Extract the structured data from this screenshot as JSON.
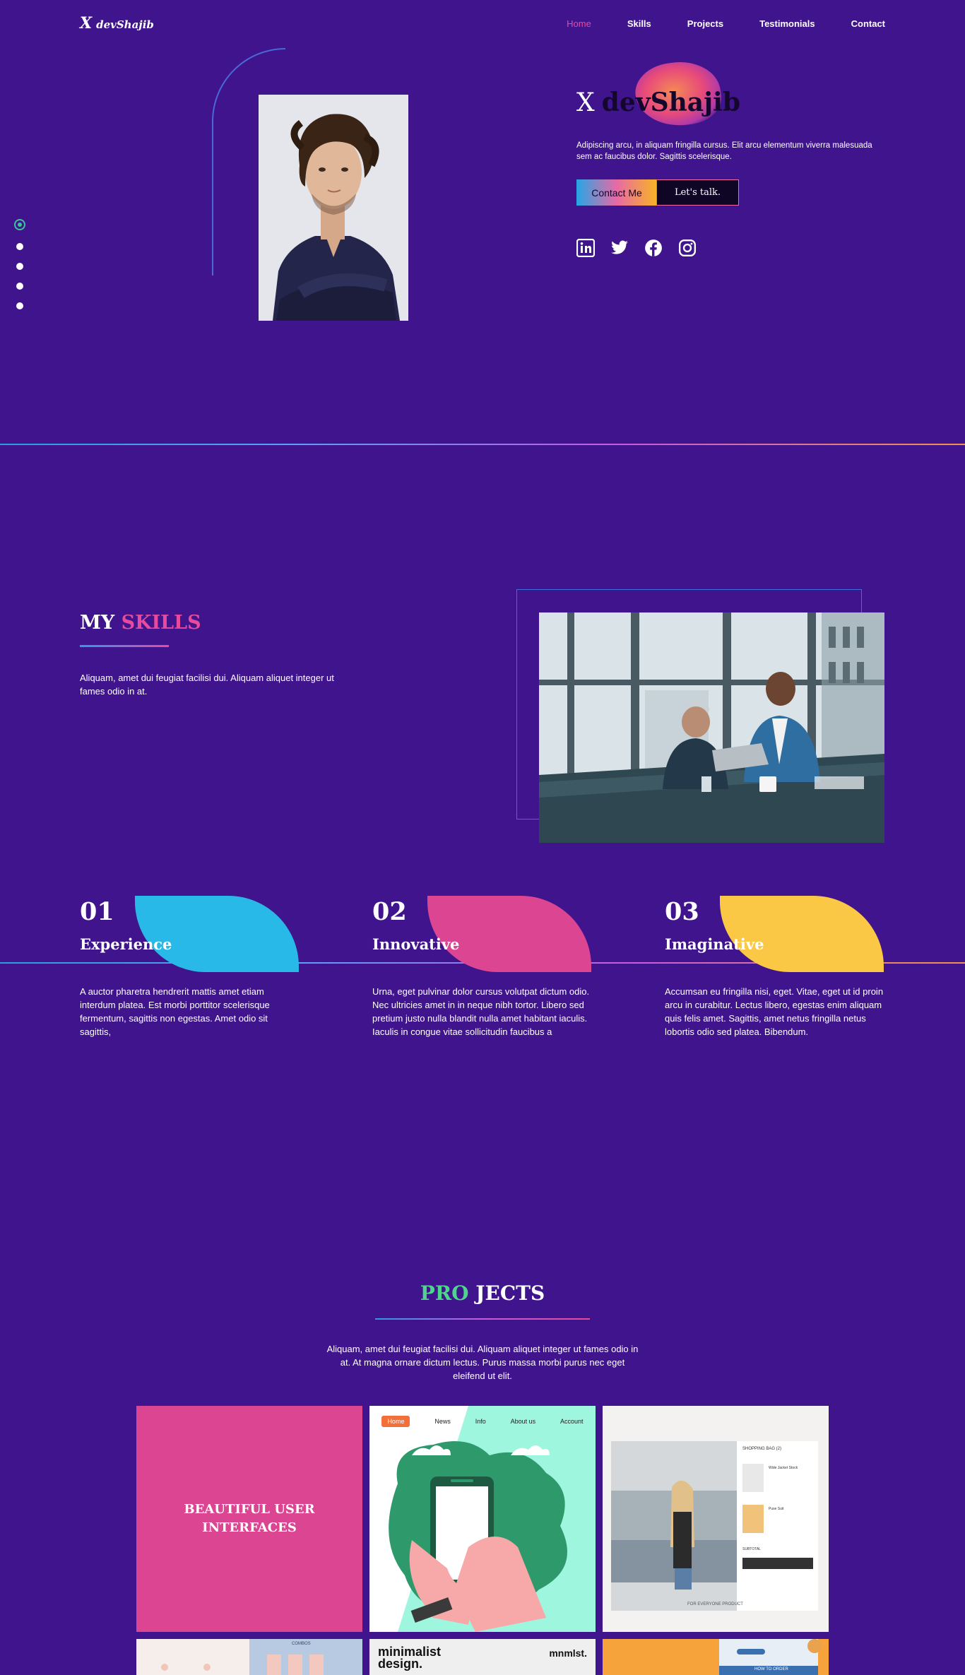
{
  "nav": {
    "logo_x": "X",
    "logo_name": "devShajib",
    "links": [
      "Home",
      "Skills",
      "Projects",
      "Testimonials",
      "Contact"
    ]
  },
  "hero": {
    "title_x": "X",
    "title_name": "devShajib",
    "description": "Adipiscing arcu, in aliquam fringilla cursus. Elit arcu elementum viverra malesuada sem ac faucibus dolor. Sagittis scelerisque.",
    "contact_button": "Contact Me",
    "talk_button": "Let's talk.",
    "social_icons": [
      "linkedin-icon",
      "twitter-icon",
      "facebook-icon",
      "instagram-icon"
    ],
    "page_dots": 5,
    "active_dot": 0
  },
  "skills": {
    "title_white": "MY",
    "title_pink": "SKILLS",
    "description": "Aliquam, amet dui feugiat facilisi dui. Aliquam aliquet integer ut fames odio in at.",
    "cards": [
      {
        "num": "01",
        "title": "Experience",
        "text": "A auctor pharetra hendrerit mattis amet etiam interdum platea. Est morbi porttitor scelerisque fermentum, sagittis non egestas. Amet odio sit sagittis,",
        "color": "#29b9e8"
      },
      {
        "num": "02",
        "title": "Innovative",
        "text": "Urna, eget pulvinar dolor cursus volutpat dictum odio. Nec ultricies amet in in neque nibh tortor. Libero sed pretium justo nulla blandit nulla amet habitant iaculis. Iaculis in congue vitae sollicitudin faucibus a",
        "color": "#db4591"
      },
      {
        "num": "03",
        "title": "Imaginative",
        "text": "Accumsan eu fringilla nisi, eget. Vitae, eget ut id proin arcu in curabitur. Lectus libero, egestas enim aliquam quis felis amet. Sagittis, amet netus fringilla netus lobortis odio sed platea. Bibendum.",
        "color": "#fbc845"
      }
    ]
  },
  "projects": {
    "title_green": "PRO",
    "title_white": "JECTS",
    "description": "Aliquam, amet dui feugiat facilisi dui. Aliquam aliquet integer ut fames odio in at. At magna ornare dictum lectus. Purus massa morbi purus nec eget eleifend ut elit.",
    "tile1_label": "BEAUTIFUL USER INTERFACES",
    "tile2_nav": [
      "Home",
      "News",
      "Info",
      "About us",
      "Account"
    ],
    "tile3_cart_title": "SHOPPING BAG (2)",
    "tile3_footer": "FOR EVERYONE PRODUCT",
    "tile3_item1": "Wide Jacket Stock",
    "tile3_item2": "Puse Suit",
    "tile3_subtotal": "SUBTOTAL",
    "tile5_text": "minimalist design.",
    "tile5_brand": "mnmlst.",
    "tile4_heading": "COMBOS",
    "tile6_label": "HOW TO ORDER"
  }
}
